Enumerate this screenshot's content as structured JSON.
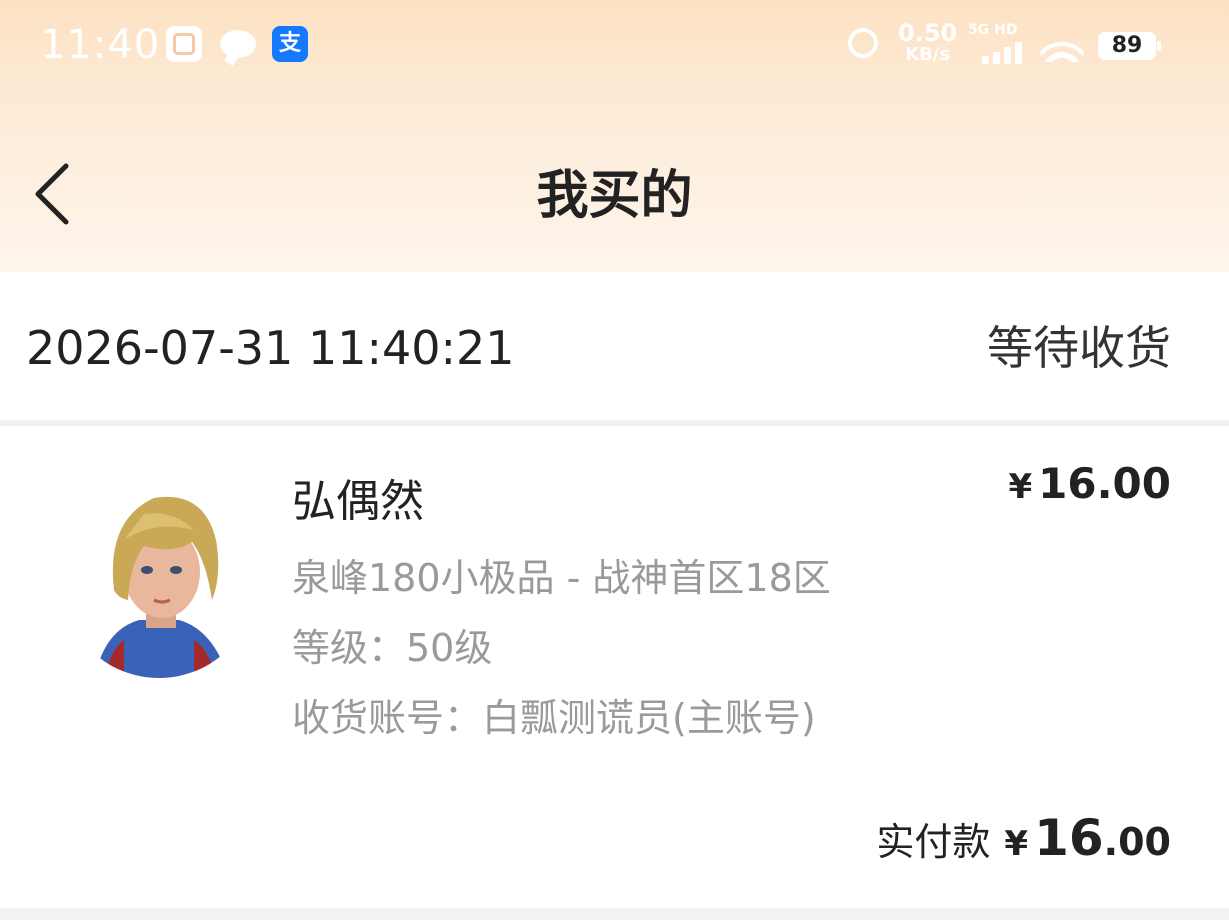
{
  "status_bar": {
    "time": "11:40",
    "speed_value": "0.50",
    "speed_unit": "KB/s",
    "network": "5G HD",
    "battery": "89",
    "icons": [
      "gallery-icon",
      "chat-icon",
      "alipay-icon",
      "alarm-icon",
      "signal-icon",
      "wifi-icon",
      "battery-icon"
    ]
  },
  "nav": {
    "title": "我买的",
    "back_icon": "chevron-left-icon"
  },
  "order": {
    "datetime": "2026-07-31 11:40:21",
    "status": "等待收货",
    "item": {
      "name": "弘偶然",
      "server": "泉峰180小极品 - 战神首区18区",
      "level": "等级：50级",
      "account": "收货账号：白瓢测谎员(主账号)",
      "price_currency": "¥",
      "price": "16.00"
    },
    "paid_label": "实付款",
    "paid_currency": "¥",
    "paid_integer": "16",
    "paid_decimal": ".00"
  },
  "colors": {
    "header_gradient_top": "#fde2c4",
    "header_gradient_bottom": "#fef5ec",
    "secondary_text": "#9a9a9a"
  }
}
